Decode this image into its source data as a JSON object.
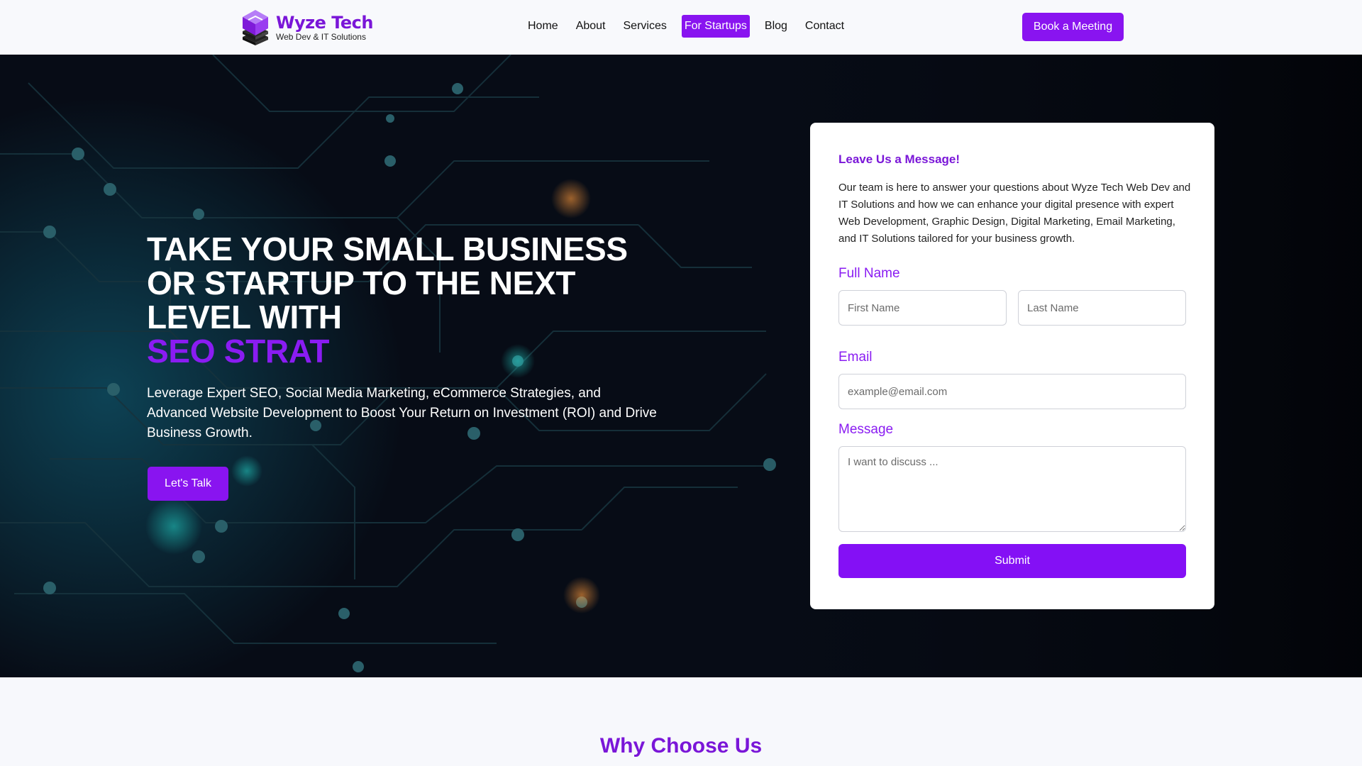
{
  "header": {
    "logo": {
      "name": "Wyze Tech",
      "tagline": "Web Dev & IT Solutions"
    },
    "nav": [
      {
        "label": "Home",
        "active": false
      },
      {
        "label": "About",
        "active": false
      },
      {
        "label": "Services",
        "active": false
      },
      {
        "label": "For Startups",
        "active": true
      },
      {
        "label": "Blog",
        "active": false
      },
      {
        "label": "Contact",
        "active": false
      }
    ],
    "cta_label": "Book a Meeting"
  },
  "hero": {
    "title_lines": [
      "TAKE YOUR SMALL BUSINESS",
      "OR STARTUP TO THE NEXT",
      "LEVEL WITH"
    ],
    "title_accent": "SEO STRAT",
    "description": "Leverage Expert SEO, Social Media Marketing, eCommerce Strategies, and Advanced Website Development to Boost Your Return on Investment (ROI) and Drive Business Growth.",
    "button_label": "Let's Talk"
  },
  "contact_form": {
    "title": "Leave Us a Message!",
    "intro": "Our team is here to answer your questions about Wyze Tech Web Dev and IT Solutions and how we can enhance your digital presence with expert Web Development, Graphic Design, Digital Marketing, Email Marketing, and IT Solutions tailored for your business growth.",
    "full_name_label": "Full Name",
    "first_name_placeholder": "First Name",
    "last_name_placeholder": "Last Name",
    "email_label": "Email",
    "email_placeholder": "example@email.com",
    "message_label": "Message",
    "message_placeholder": "I want to discuss ...",
    "submit_label": "Submit"
  },
  "why_section": {
    "title": "Why Choose Us"
  },
  "colors": {
    "brand_purple": "#8914f0",
    "accent_text": "#7a16d8",
    "hero_bg": "#05080f",
    "circuit_line": "#1a3a44",
    "circuit_node": "#2f6c73"
  },
  "icons": {
    "logo": "stacked-cube-logo-icon",
    "textarea_resize": "resize-grip-icon"
  }
}
